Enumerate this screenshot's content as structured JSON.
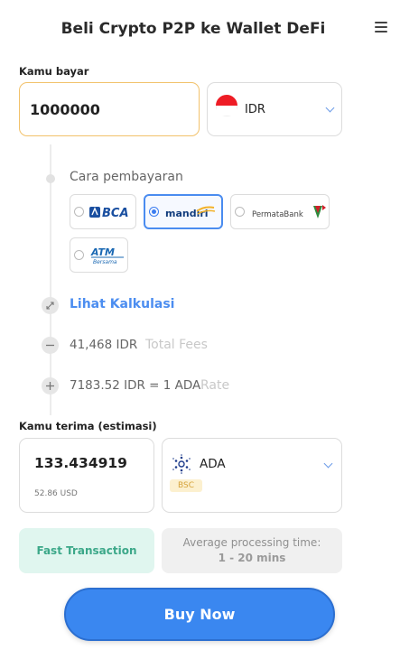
{
  "header": {
    "title": "Beli Crypto P2P ke Wallet DeFi",
    "menu_icon": "hamburger-menu-icon"
  },
  "pay": {
    "label": "Kamu bayar",
    "amount": "1000000",
    "currency": "IDR",
    "flag_colors": {
      "top": "#ee1c25",
      "bottom": "#ffffff"
    }
  },
  "payment": {
    "label": "Cara pembayaran",
    "methods": [
      {
        "name": "BCA",
        "selected": false
      },
      {
        "name": "mandiri",
        "selected": true
      },
      {
        "name": "PermataBank",
        "selected": false
      },
      {
        "name": "ATM Bersama",
        "selected": false
      }
    ]
  },
  "calculator": {
    "link": "Lihat Kalkulasi",
    "fees_value": "41,468 IDR",
    "fees_label": "Total Fees",
    "rate_value": "7183.52 IDR = 1 ADA",
    "rate_label": "Rate"
  },
  "receive": {
    "label": "Kamu terima (estimasi)",
    "amount": "133.434919",
    "usd": "52.86 USD",
    "coin": "ADA",
    "network": "BSC"
  },
  "info": {
    "fast": "Fast Transaction",
    "avg_label": "Average processing time:",
    "avg_value": "1 - 20 mins"
  },
  "actions": {
    "buy": "Buy Now"
  },
  "colors": {
    "accent": "#3a87f0",
    "amount_border": "#f2c26b",
    "fast_bg": "#e0f6ef",
    "fast_text": "#3ca889"
  }
}
